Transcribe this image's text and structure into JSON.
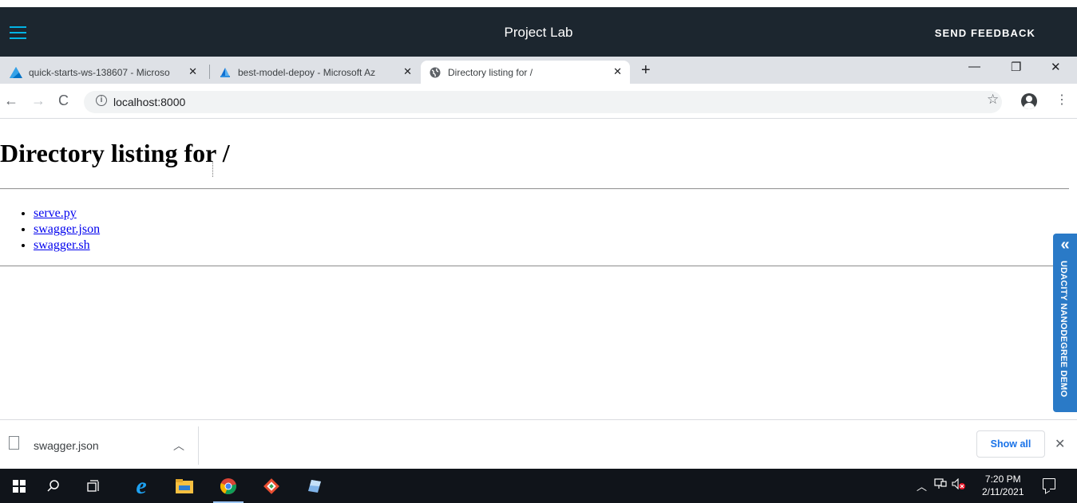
{
  "udacity_bar": {
    "title": "Project Lab",
    "feedback_label": "SEND FEEDBACK"
  },
  "browser": {
    "tabs": [
      {
        "title": "quick-starts-ws-138607 - Microso",
        "icon": "azure-ml-icon"
      },
      {
        "title": "best-model-depoy - Microsoft Az",
        "icon": "azure-ml-studio-icon"
      },
      {
        "title": "Directory listing for /",
        "icon": "globe-icon",
        "active": true
      }
    ],
    "new_tab_label": "+",
    "window_controls": {
      "minimize": "—",
      "restore": "❐",
      "close": "✕"
    },
    "url": "localhost:8000",
    "info_icon": "i"
  },
  "page": {
    "heading": "Directory listing for /",
    "files": [
      "serve.py",
      "swagger.json",
      "swagger.sh"
    ]
  },
  "side_tab": {
    "label": "UDACITY NANODEGREE DEMO",
    "chevron": "«"
  },
  "download_shelf": {
    "file_name": "swagger.json",
    "show_all_label": "Show all"
  },
  "taskbar": {
    "time": "7:20 PM",
    "date": "2/11/2021",
    "apps": [
      "windows-start-icon",
      "search-icon",
      "task-view-icon",
      "internet-explorer-icon",
      "file-explorer-icon",
      "chrome-icon",
      "git-icon",
      "notepad-icon"
    ],
    "colors": {
      "accent": "#02b3e4",
      "side_tab": "#2a7ac7",
      "link": "#0000ee"
    }
  }
}
